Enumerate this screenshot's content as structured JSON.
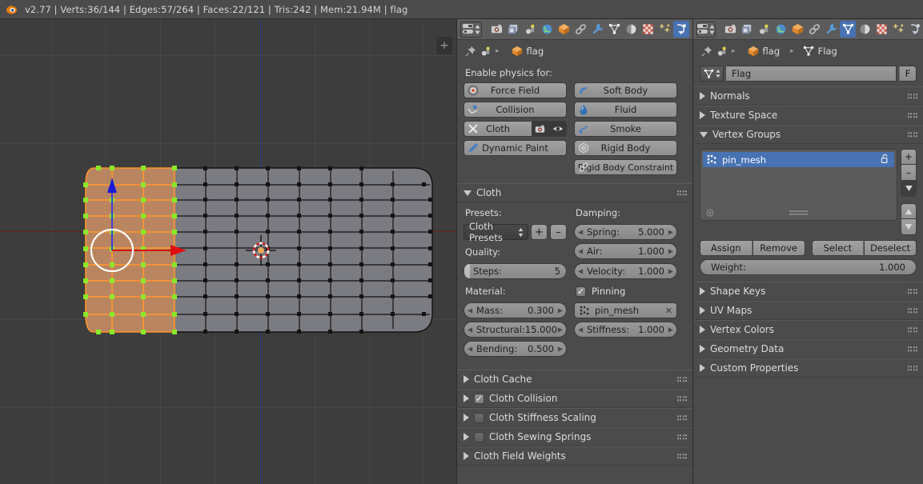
{
  "topbar": {
    "logo_icon": "blender-logo",
    "text": "v2.77 | Verts:36/144 | Edges:57/264 | Faces:22/121 | Tris:242 | Mem:21.94M | flag"
  },
  "viewport": {
    "toolbar_toggle_label": "+",
    "cursor_icon": "3d-cursor",
    "manipulator_icon": "translate-manipulator",
    "axis_x_color": "#6b2020",
    "axis_z_color": "#2b3d8f",
    "background_color": "#3d3d3d",
    "selection_color": "#ff9933",
    "vertex_selected_color": "#7ddc1e"
  },
  "properties_physics": {
    "editor_icon": "properties-editor-icon",
    "tabs": [
      {
        "name": "render",
        "icon": "camera-icon",
        "active": false
      },
      {
        "name": "render-layers",
        "icon": "render-layers-icon",
        "active": false
      },
      {
        "name": "scene",
        "icon": "scene-icon",
        "active": false
      },
      {
        "name": "world",
        "icon": "world-icon",
        "active": false
      },
      {
        "name": "object",
        "icon": "cube-icon",
        "active": false
      },
      {
        "name": "constraints",
        "icon": "chain-icon",
        "active": false
      },
      {
        "name": "modifiers",
        "icon": "wrench-icon",
        "active": false
      },
      {
        "name": "data",
        "icon": "mesh-data-icon",
        "active": false
      },
      {
        "name": "material",
        "icon": "material-sphere-icon",
        "active": false
      },
      {
        "name": "texture",
        "icon": "checker-icon",
        "active": false
      },
      {
        "name": "particles",
        "icon": "particles-icon",
        "active": false
      },
      {
        "name": "physics",
        "icon": "physics-icon",
        "active": true
      }
    ],
    "breadcrumb": {
      "pin_icon": "pin-icon",
      "scene_icon": "scene-icon",
      "object_icon": "cube-icon",
      "object_name": "flag"
    },
    "enable_label": "Enable physics for:",
    "physics_buttons_left": [
      {
        "label": "Force Field",
        "icon": "force-field-icon"
      },
      {
        "label": "Collision",
        "icon": "collision-icon"
      },
      {
        "label": "Cloth",
        "icon": "cloth-icon",
        "enabled": true,
        "render_toggle_icon": "camera-icon",
        "viewport_toggle_icon": "eye-icon"
      },
      {
        "label": "Dynamic Paint",
        "icon": "dynamic-paint-icon"
      }
    ],
    "physics_buttons_right": [
      {
        "label": "Soft Body",
        "icon": "soft-body-icon"
      },
      {
        "label": "Fluid",
        "icon": "fluid-icon"
      },
      {
        "label": "Smoke",
        "icon": "smoke-icon"
      },
      {
        "label": "Rigid Body",
        "icon": "rigid-body-icon"
      },
      {
        "label": "Rigid Body Constraint",
        "icon": "rigid-body-constraint-icon"
      }
    ],
    "cloth_panel": {
      "title": "Cloth",
      "expanded": true,
      "presets_label": "Presets:",
      "preset_value": "Cloth Presets",
      "preset_add_label": "+",
      "preset_remove_label": "–",
      "quality_label": "Quality:",
      "steps": {
        "label": "Steps:",
        "value": "5"
      },
      "material_label": "Material:",
      "mass": {
        "label": "Mass:",
        "value": "0.300"
      },
      "structural": {
        "label": "Structural:",
        "value": "15.000"
      },
      "bending": {
        "label": "Bending:",
        "value": "0.500"
      },
      "damping_label": "Damping:",
      "spring": {
        "label": "Spring:",
        "value": "5.000"
      },
      "air": {
        "label": "Air:",
        "value": "1.000"
      },
      "velocity": {
        "label": "Velocity:",
        "value": "1.000"
      },
      "pinning": {
        "label": "Pinning",
        "checked": true
      },
      "pin_group": {
        "value": "pin_mesh",
        "icon": "vertex-group-icon",
        "clear_icon": "x-icon"
      },
      "stiffness": {
        "label": "Stiffness:",
        "value": "1.000"
      }
    },
    "sub_panels": [
      {
        "label": "Cloth Cache",
        "expanded": false,
        "has_checkbox": false
      },
      {
        "label": "Cloth Collision",
        "expanded": false,
        "has_checkbox": true,
        "checked": true
      },
      {
        "label": "Cloth Stiffness Scaling",
        "expanded": false,
        "has_checkbox": true,
        "checked": false
      },
      {
        "label": "Cloth Sewing Springs",
        "expanded": false,
        "has_checkbox": true,
        "checked": false
      },
      {
        "label": "Cloth Field Weights",
        "expanded": false,
        "has_checkbox": false
      }
    ]
  },
  "properties_data": {
    "editor_icon": "properties-editor-icon",
    "tabs": [
      {
        "name": "render",
        "icon": "camera-icon",
        "active": false
      },
      {
        "name": "render-layers",
        "icon": "render-layers-icon",
        "active": false
      },
      {
        "name": "scene",
        "icon": "scene-icon",
        "active": false
      },
      {
        "name": "world",
        "icon": "world-icon",
        "active": false
      },
      {
        "name": "object",
        "icon": "cube-icon",
        "active": false
      },
      {
        "name": "constraints",
        "icon": "chain-icon",
        "active": false
      },
      {
        "name": "modifiers",
        "icon": "wrench-icon",
        "active": false
      },
      {
        "name": "data",
        "icon": "mesh-data-icon",
        "active": true
      },
      {
        "name": "material",
        "icon": "material-sphere-icon",
        "active": false
      },
      {
        "name": "texture",
        "icon": "checker-icon",
        "active": false
      },
      {
        "name": "particles",
        "icon": "particles-icon",
        "active": false
      },
      {
        "name": "physics",
        "icon": "physics-icon",
        "active": false
      }
    ],
    "breadcrumb": {
      "pin_icon": "pin-icon",
      "object_name": "flag",
      "data_name": "Flag"
    },
    "datablock": {
      "name": "Flag",
      "fake_user_label": "F",
      "icon": "mesh-data-icon"
    },
    "panels_before": [
      {
        "label": "Normals",
        "expanded": false
      },
      {
        "label": "Texture Space",
        "expanded": false
      }
    ],
    "vertex_groups": {
      "title": "Vertex Groups",
      "expanded": true,
      "items": [
        {
          "name": "pin_mesh",
          "selected": true,
          "icon": "vertex-group-icon",
          "lock_icon": "unlock-icon"
        }
      ],
      "add_label": "+",
      "remove_label": "–",
      "specials_icon": "chevron-down-icon",
      "move_up_icon": "triangle-up-icon",
      "move_down_icon": "triangle-down-icon",
      "assign_label": "Assign",
      "remove_button_label": "Remove",
      "select_label": "Select",
      "deselect_label": "Deselect",
      "weight": {
        "label": "Weight:",
        "value": "1.000"
      }
    },
    "panels_after": [
      {
        "label": "Shape Keys",
        "expanded": false
      },
      {
        "label": "UV Maps",
        "expanded": false
      },
      {
        "label": "Vertex Colors",
        "expanded": false
      },
      {
        "label": "Geometry Data",
        "expanded": false
      },
      {
        "label": "Custom Properties",
        "expanded": false
      }
    ]
  }
}
